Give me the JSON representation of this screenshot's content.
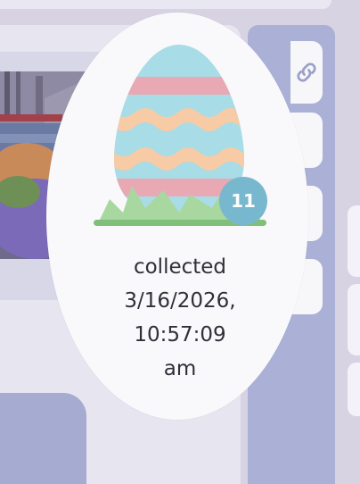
{
  "badge": {
    "count": "11"
  },
  "collected": {
    "label": "collected",
    "date": "3/16/2026,",
    "time": "10:57:09",
    "ampm": "am"
  },
  "icons": {
    "link": "link-icon",
    "egg": "easter-egg-icon"
  },
  "colors": {
    "egg_blue": "#a8dce6",
    "egg_pink": "#e8a8b4",
    "egg_peach": "#f6cba6",
    "grass": "#a8d8a0",
    "badge": "#78b8cf",
    "side_panel": "#aab0d6",
    "text": "#2f3038"
  }
}
